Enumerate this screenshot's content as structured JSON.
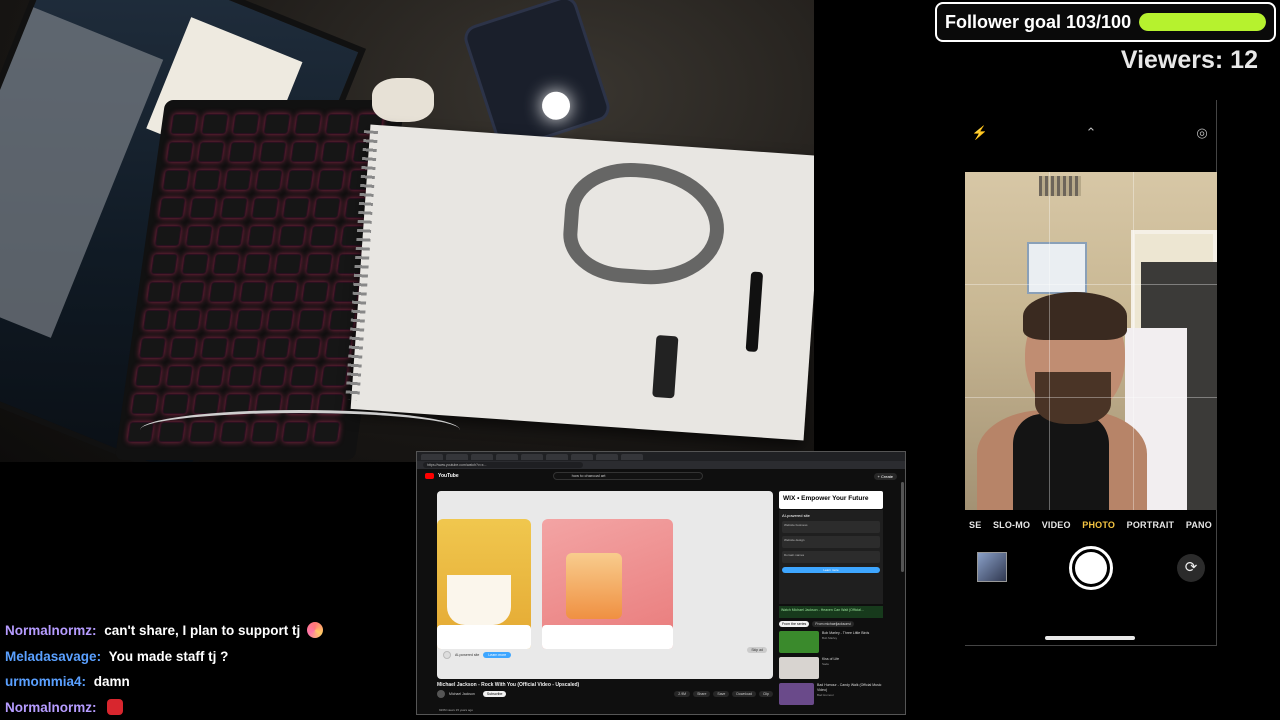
{
  "overlay": {
    "follower_goal": "Follower goal 103/100",
    "follower_progress": 1.0,
    "goal_color": "#b6f22e",
    "viewers": "Viewers: 12"
  },
  "phone_camera": {
    "modes": [
      "SE",
      "SLO-MO",
      "VIDEO",
      "PHOTO",
      "PORTRAIT",
      "PANO"
    ],
    "active_mode": "PHOTO",
    "active_color": "#f5c542",
    "top_icons": [
      "flash-off-icon",
      "chevron-up-icon",
      "live-photo-off-icon"
    ]
  },
  "chat": {
    "messages": [
      {
        "user": "Normalnormz",
        "color": "#b69cff",
        "text": "can't share, I plan to support tj",
        "emote": "pink-spiral-emote"
      },
      {
        "user": "Meladasavage",
        "color": "#5aa0ff",
        "text": "You made staff tj ?",
        "emote": ""
      },
      {
        "user": "urmommia4",
        "color": "#5aa0ff",
        "text": "damn",
        "emote": ""
      },
      {
        "user": "Normalnormz",
        "color": "#b69cff",
        "text": "",
        "emote": "red-face-emote"
      }
    ]
  },
  "browser": {
    "url": "https://www.youtube.com/watch?v=x...",
    "search_query": "how to charcoal art",
    "yt_logo": "YouTube",
    "create_label": "+ Create",
    "ad_channel": "AI-powered site",
    "ad_button": "Learn more",
    "skip_label": "Skip ad",
    "video_title": "Michael Jackson - Rock With You (Official Video - Upscaled)",
    "channel": "Michael Jackson",
    "subscribe": "Subscribe",
    "actions": [
      "2.9M",
      "Share",
      "Save",
      "Download",
      "Clip"
    ],
    "description": "926M views  15 years ago",
    "side_banner": "WIX • Empower Your Future",
    "wix_head": "AI-powered site",
    "wix_rows": [
      "Website business",
      "Website design",
      "Domain names"
    ],
    "wix_button": "Learn more",
    "related_banner": "Watch Michael Jackson - Heaven Can Wait (Official...",
    "chips": [
      "From the series",
      "From michaeljacksonvi"
    ],
    "related": [
      {
        "title": "Bob Marley - Three Little Birds",
        "sub": "Bob Marley",
        "color": "#3a8a2c"
      },
      {
        "title": "Kiss of Life",
        "sub": "Sade",
        "color": "#d8d4d0"
      },
      {
        "title": "Bad Humour - Candy Walk (Official Music Video)",
        "sub": "Bad Humour",
        "color": "#6a4a8a"
      }
    ]
  }
}
